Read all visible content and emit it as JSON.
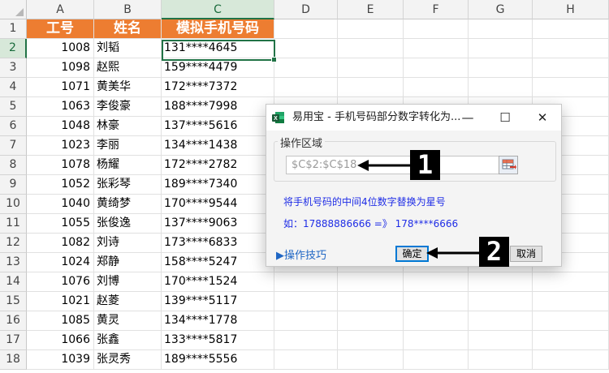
{
  "columns": [
    "A",
    "B",
    "C",
    "D",
    "E",
    "F",
    "G",
    "H"
  ],
  "selected_column": "C",
  "rows": [
    {
      "n": "1",
      "id": "工号",
      "name": "姓名",
      "phone": "模拟手机号码"
    },
    {
      "n": "2",
      "id": "1008",
      "name": "刘韬",
      "phone": "131****4645"
    },
    {
      "n": "3",
      "id": "1098",
      "name": "赵熙",
      "phone": "159****4479"
    },
    {
      "n": "4",
      "id": "1071",
      "name": "黄美华",
      "phone": "172****7372"
    },
    {
      "n": "5",
      "id": "1063",
      "name": "李俊豪",
      "phone": "188****7998"
    },
    {
      "n": "6",
      "id": "1048",
      "name": "林豪",
      "phone": "137****5616"
    },
    {
      "n": "7",
      "id": "1023",
      "name": "李丽",
      "phone": "134****1438"
    },
    {
      "n": "8",
      "id": "1078",
      "name": "杨耀",
      "phone": "172****2782"
    },
    {
      "n": "9",
      "id": "1052",
      "name": "张彩琴",
      "phone": "189****7340"
    },
    {
      "n": "10",
      "id": "1040",
      "name": "黄绮梦",
      "phone": "170****9544"
    },
    {
      "n": "11",
      "id": "1055",
      "name": "张俊逸",
      "phone": "137****9063"
    },
    {
      "n": "12",
      "id": "1082",
      "name": "刘诗",
      "phone": "173****6833"
    },
    {
      "n": "13",
      "id": "1024",
      "name": "郑静",
      "phone": "158****5247"
    },
    {
      "n": "14",
      "id": "1076",
      "name": "刘博",
      "phone": "170****1524"
    },
    {
      "n": "15",
      "id": "1021",
      "name": "赵菱",
      "phone": "139****5117"
    },
    {
      "n": "16",
      "id": "1085",
      "name": "黄灵",
      "phone": "134****1778"
    },
    {
      "n": "17",
      "id": "1066",
      "name": "张鑫",
      "phone": "133****5817"
    },
    {
      "n": "18",
      "id": "1039",
      "name": "张灵秀",
      "phone": "189****5556"
    }
  ],
  "dialog": {
    "title": "易用宝 - 手机号码部分数字转化为...",
    "minimize": "—",
    "maximize": "☐",
    "close": "✕",
    "group_label": "操作区域",
    "range_value": "$C$2:$C$18",
    "info_line1": "将手机号码的中间4位数字替换为星号",
    "info_line2": "如：17888886666 =》 178****6666",
    "tips_link": "▶操作技巧",
    "ok_label": "确定",
    "cancel_label": "取消"
  },
  "annotations": [
    {
      "label": "1"
    },
    {
      "label": "2"
    }
  ],
  "colors": {
    "header_fill": "#ed7d31",
    "excel_green": "#217346",
    "info_blue": "#1f2de6"
  }
}
